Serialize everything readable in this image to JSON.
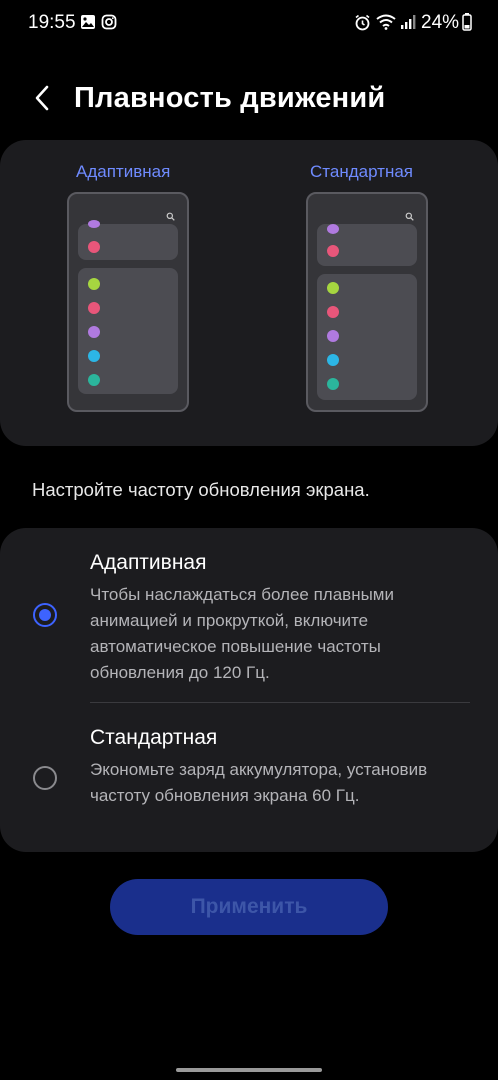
{
  "status_bar": {
    "time": "19:55",
    "battery": "24%",
    "icons": [
      "gallery-icon",
      "instagram-icon",
      "alarm-icon",
      "wifi-icon",
      "signal-icon",
      "battery-icon"
    ]
  },
  "header": {
    "title": "Плавность движений",
    "back_icon": "chevron-left-icon"
  },
  "preview": {
    "adaptive_label": "Адаптивная",
    "standard_label": "Стандартная",
    "dot_colors": [
      "#a6d640",
      "#e8567a",
      "#b07ae0",
      "#2cb6e6",
      "#2bb59c"
    ],
    "accent_label_color": "#6f8bff"
  },
  "hint": "Настройте частоту обновления экрана.",
  "options": [
    {
      "title": "Адаптивная",
      "description": "Чтобы наслаждаться более плавными анимацией и прокруткой, включите автоматическое повышение частоты обновления до 120 Гц.",
      "selected": true
    },
    {
      "title": "Стандартная",
      "description": "Экономьте заряд аккумулятора, установив частоту обновления экрана 60 Гц.",
      "selected": false
    }
  ],
  "apply_button": "Применить",
  "colors": {
    "accent": "#3d63ff",
    "card": "#1c1c1f",
    "button_bg": "#1a2f8c"
  }
}
